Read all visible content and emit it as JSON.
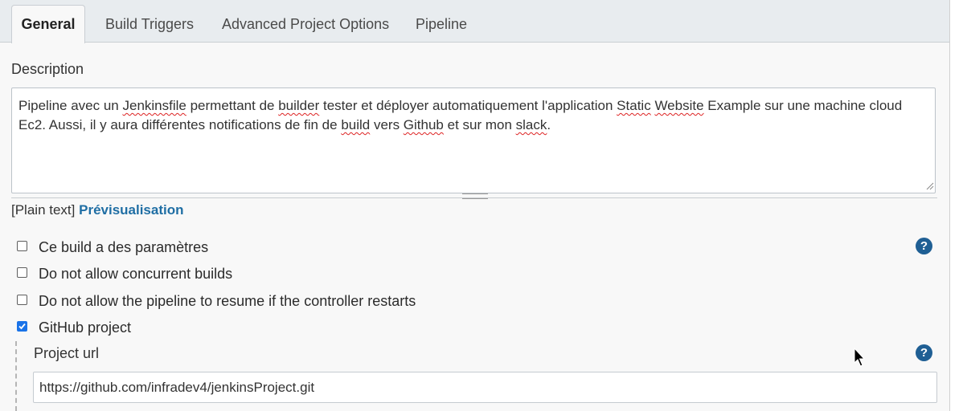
{
  "tabs": [
    {
      "label": "General",
      "active": true
    },
    {
      "label": "Build Triggers",
      "active": false
    },
    {
      "label": "Advanced Project Options",
      "active": false
    },
    {
      "label": "Pipeline",
      "active": false
    }
  ],
  "description": {
    "label": "Description",
    "text_parts": [
      "Pipeline avec un ",
      "Jenkinsfile",
      " permettant de ",
      "builder",
      " tester et déployer automatiquement  l'application ",
      "Static",
      " ",
      "Website",
      " Example sur une machine cloud Ec2. Aussi,  il y aura différentes notifications de fin de ",
      "build",
      " vers ",
      "Github",
      " et sur mon ",
      "slack",
      "."
    ],
    "format_prefix": "[Plain text]",
    "preview_link": "Prévisualisation"
  },
  "options": [
    {
      "label": "Ce build a des paramètres",
      "checked": false,
      "help": true
    },
    {
      "label": "Do not allow concurrent builds",
      "checked": false,
      "help": false
    },
    {
      "label": "Do not allow the pipeline to resume if the controller restarts",
      "checked": false,
      "help": false
    },
    {
      "label": "GitHub project",
      "checked": true,
      "help": false
    }
  ],
  "github_project": {
    "project_url_label": "Project url",
    "project_url_value": "https://github.com/infradev4/jenkinsProject.git"
  },
  "help_icon_text": "?",
  "colors": {
    "link": "#1f6ea4",
    "help_icon": "#1f5f94",
    "checkbox_checked": "#1a73e8",
    "tabbar_bg": "#e8ecef"
  }
}
